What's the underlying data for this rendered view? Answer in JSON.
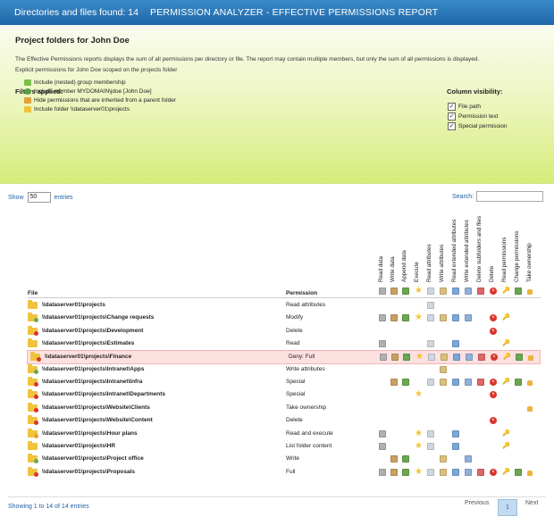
{
  "header": {
    "count": "Directories and files found: 14",
    "title": "PERMISSION ANALYZER - EFFECTIVE PERMISSIONS REPORT"
  },
  "hero": {
    "title": "Project folders for John Doe",
    "description": "The Effective Permissions reports displays the sum of all permissions per directory or file. The report may contain multiple members, but only the sum of all permissions is displayed.",
    "description2": "Explicit permissions for John Doe scoped on the projects folder",
    "filters_title": "Filters applied:",
    "filters": [
      {
        "icon": "group-membership-icon",
        "label": "Include (nested) group membership"
      },
      {
        "icon": "user-icon",
        "label": "Include member MYDOMAIN\\jdoe [John Doe]"
      },
      {
        "icon": "inherited-icon",
        "label": "Hide permissions that are inherited from a parent folder"
      },
      {
        "icon": "folder-icon",
        "label": "Include folder \\\\dataserver01\\projects"
      }
    ],
    "colvis_title": "Column visibility:",
    "colvis": [
      {
        "label": "File path",
        "checked": true
      },
      {
        "label": "Permission text",
        "checked": true
      },
      {
        "label": "Special permission",
        "checked": true
      }
    ]
  },
  "controls": {
    "show_label": "Show",
    "show_value": "50",
    "entries_label": "entries",
    "search_label": "Search:"
  },
  "columns": {
    "file": "File",
    "permission": "Permission",
    "perms": [
      "Read data",
      "Write data",
      "Append data",
      "Execute",
      "Read attributes",
      "Write attributes",
      "Read extended attributes",
      "Write extended attributes",
      "Delete subfolders and files",
      "Delete",
      "Read permissions",
      "Change permissions",
      "Take ownership"
    ]
  },
  "rows": [
    {
      "path": "\\\\dataserver01\\projects",
      "perm": "Read attributes",
      "badge": "",
      "flags": [
        0,
        0,
        0,
        0,
        1,
        0,
        0,
        0,
        0,
        0,
        0,
        0,
        0
      ]
    },
    {
      "path": "\\\\dataserver01\\projects\\Change requests",
      "perm": "Modify",
      "badge": "group",
      "flags": [
        1,
        1,
        1,
        1,
        1,
        1,
        1,
        1,
        0,
        1,
        1,
        0,
        0
      ]
    },
    {
      "path": "\\\\dataserver01\\projects\\Development",
      "perm": "Delete",
      "badge": "deny",
      "flags": [
        0,
        0,
        0,
        0,
        0,
        0,
        0,
        0,
        0,
        1,
        0,
        0,
        0
      ]
    },
    {
      "path": "\\\\dataserver01\\projects\\Estimates",
      "perm": "Read",
      "badge": "",
      "flags": [
        1,
        0,
        0,
        0,
        1,
        0,
        1,
        0,
        0,
        0,
        1,
        0,
        0
      ]
    },
    {
      "path": "\\\\dataserver01\\projects\\Finance",
      "perm": "Deny: Full",
      "badge": "deny",
      "highlight": true,
      "flags": [
        1,
        1,
        1,
        1,
        1,
        1,
        1,
        1,
        1,
        1,
        1,
        1,
        1
      ]
    },
    {
      "path": "\\\\dataserver01\\projects\\Intranet\\Apps",
      "perm": "Write attributes",
      "badge": "group",
      "flags": [
        0,
        0,
        0,
        0,
        0,
        1,
        0,
        0,
        0,
        0,
        0,
        0,
        0
      ]
    },
    {
      "path": "\\\\dataserver01\\projects\\Intranet\\Infra",
      "perm": "Special",
      "badge": "deny",
      "flags": [
        0,
        1,
        1,
        0,
        1,
        1,
        1,
        1,
        1,
        1,
        1,
        1,
        1
      ]
    },
    {
      "path": "\\\\dataserver01\\projects\\Intranet\\Departments",
      "perm": "Special",
      "badge": "deny",
      "flags": [
        0,
        0,
        0,
        1,
        0,
        0,
        0,
        0,
        0,
        1,
        0,
        0,
        0
      ]
    },
    {
      "path": "\\\\dataserver01\\projects\\Website\\Clients",
      "perm": "Take ownership",
      "badge": "deny",
      "flags": [
        0,
        0,
        0,
        0,
        0,
        0,
        0,
        0,
        0,
        0,
        0,
        0,
        1
      ]
    },
    {
      "path": "\\\\dataserver01\\projects\\Website\\Content",
      "perm": "Delete",
      "badge": "deny",
      "flags": [
        0,
        0,
        0,
        0,
        0,
        0,
        0,
        0,
        0,
        1,
        0,
        0,
        0
      ]
    },
    {
      "path": "\\\\dataserver01\\projects\\Hour plans",
      "perm": "Read and execute",
      "badge": "user",
      "flags": [
        1,
        0,
        0,
        1,
        1,
        0,
        1,
        0,
        0,
        0,
        1,
        0,
        0
      ]
    },
    {
      "path": "\\\\dataserver01\\projects\\HR",
      "perm": "List folder content",
      "badge": "",
      "flags": [
        1,
        0,
        0,
        1,
        1,
        0,
        1,
        0,
        0,
        0,
        1,
        0,
        0
      ]
    },
    {
      "path": "\\\\dataserver01\\projects\\Project office",
      "perm": "Write",
      "badge": "group",
      "flags": [
        0,
        1,
        1,
        0,
        0,
        1,
        0,
        1,
        0,
        0,
        0,
        0,
        0
      ]
    },
    {
      "path": "\\\\dataserver01\\projects\\Proposals",
      "perm": "Full",
      "badge": "deny",
      "flags": [
        1,
        1,
        1,
        1,
        1,
        1,
        1,
        1,
        1,
        1,
        1,
        1,
        1
      ]
    }
  ],
  "footer": {
    "info": "Showing 1 to 14 of 14 entries",
    "previous": "Previous",
    "page": "1",
    "next": "Next"
  },
  "colors": {
    "header_bg": "#2776b8",
    "hero_bg": "#e6f3b0",
    "deny_highlight": "#fde0e0",
    "link": "#1f5fa8"
  }
}
